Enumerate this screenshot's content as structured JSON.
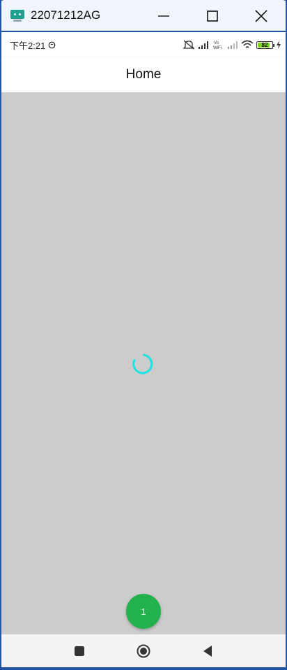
{
  "window": {
    "title": "22071212AG",
    "controls": [
      "minimize",
      "maximize",
      "close"
    ]
  },
  "status_bar": {
    "time": "下午2:21",
    "icons": [
      "mute-icon",
      "volte-signal-icon",
      "vowifi-icon",
      "signal-icon",
      "wifi-icon",
      "battery-icon",
      "charging-icon"
    ],
    "vowifi_text": "Vo\nWiFi",
    "battery_level": "82"
  },
  "app_bar": {
    "title": "Home"
  },
  "content": {
    "loading": true,
    "spinner_color": "#19e3e3"
  },
  "fab": {
    "label": "1",
    "color": "#22b14c"
  },
  "nav_bar": {
    "buttons": [
      "recents",
      "home",
      "back"
    ]
  }
}
